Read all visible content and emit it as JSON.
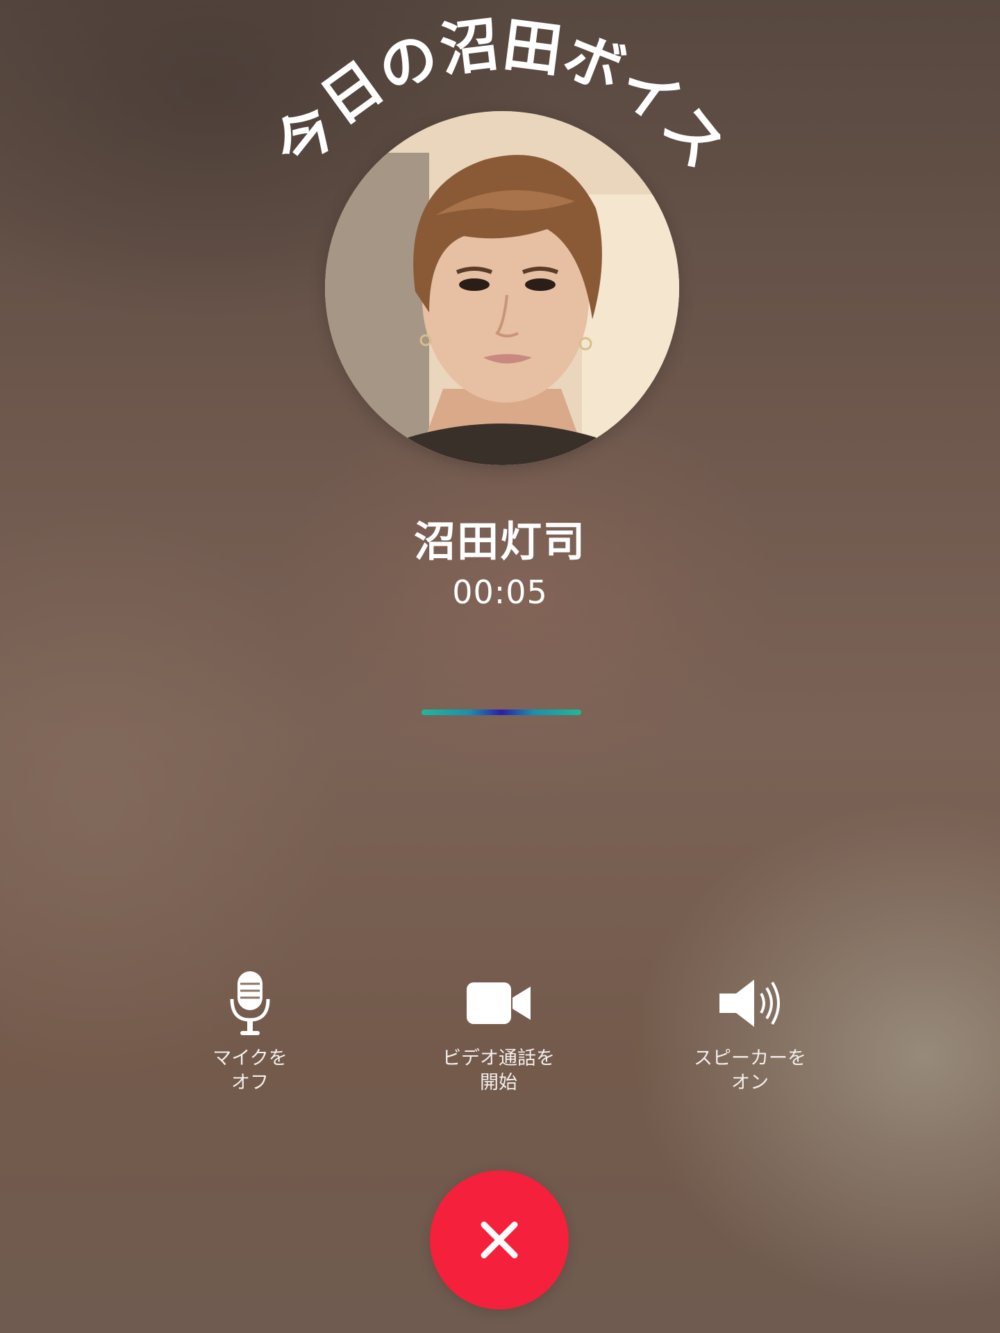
{
  "header": {
    "arc_title": "今日の沼田ボイス"
  },
  "call": {
    "caller_name": "沼田灯司",
    "timer": "00:05",
    "avatar_icon": "profile-photo"
  },
  "controls": {
    "mic": {
      "label": "マイクを\nオフ",
      "icon": "microphone-icon"
    },
    "video": {
      "label": "ビデオ通話を\n開始",
      "icon": "video-camera-icon"
    },
    "speaker": {
      "label": "スピーカーを\nオン",
      "icon": "speaker-icon"
    },
    "end_call": {
      "icon": "close-icon"
    }
  },
  "colors": {
    "end_call": "#f5203b",
    "wave_edge": "#1fb89a",
    "wave_center": "#2a1fa8"
  }
}
